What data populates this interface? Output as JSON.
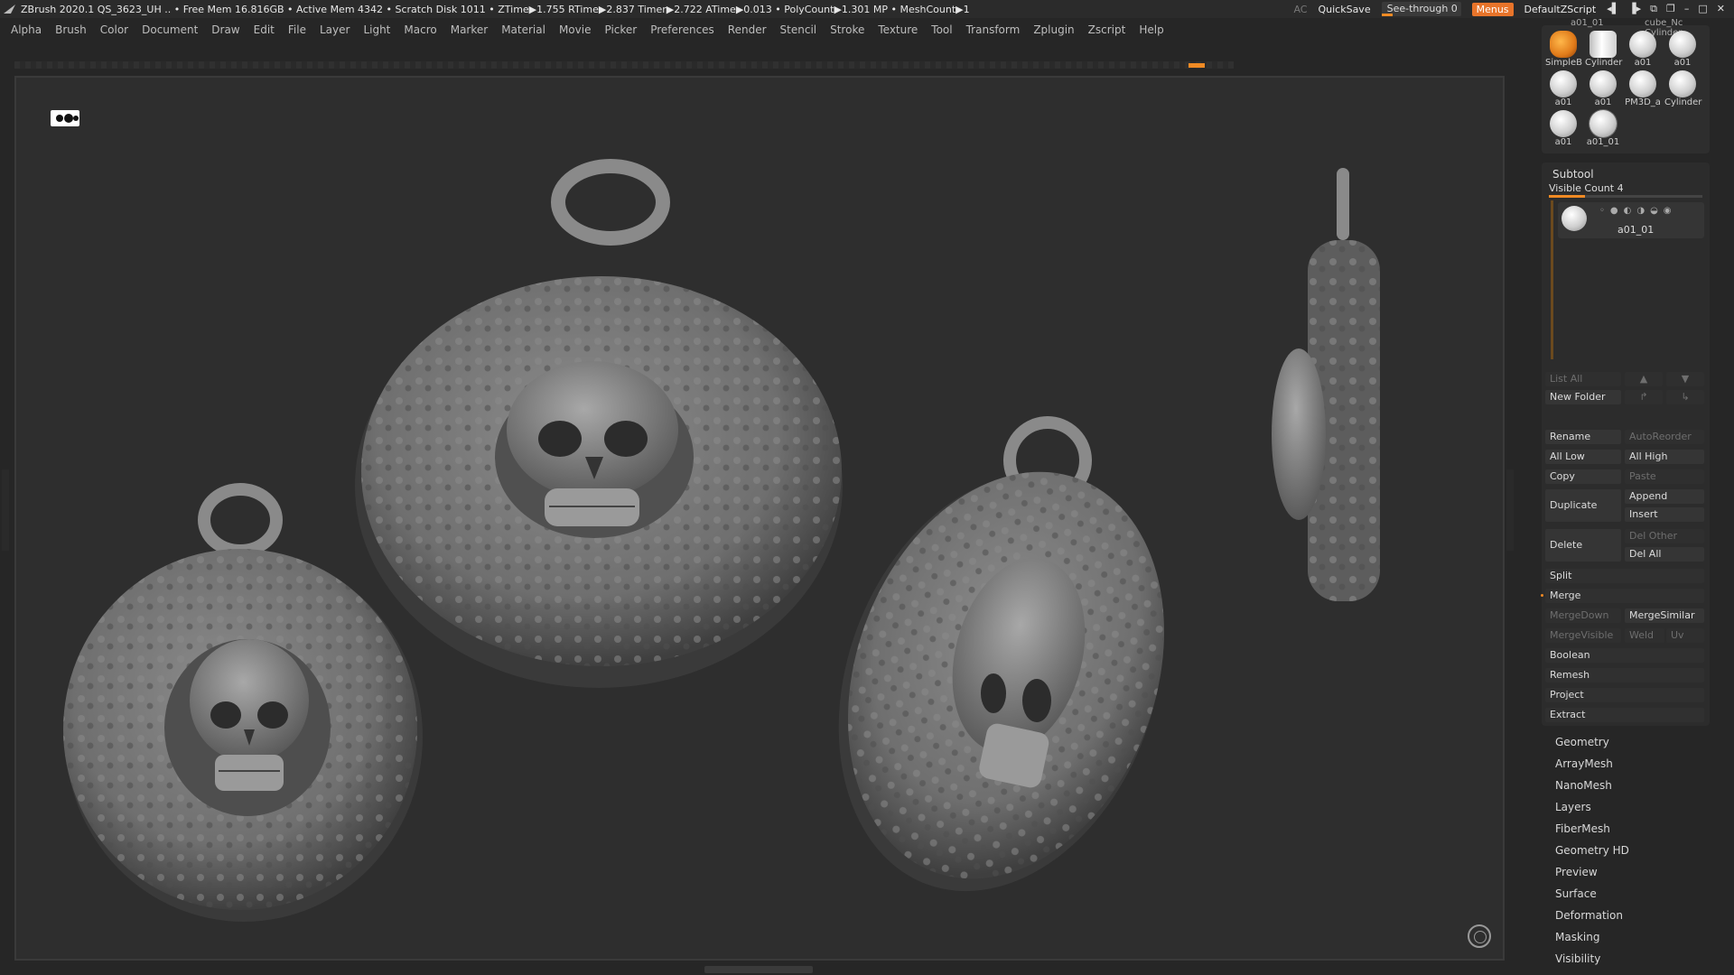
{
  "titlebar": {
    "info": "ZBrush 2020.1   QS_3623_UH   .. • Free Mem 16.816GB • Active Mem 4342 • Scratch Disk 1011 • ZTime▶1.755 RTime▶2.837 Timer▶2.722 ATime▶0.013 • PolyCount▶1.301 MP  • MeshCount▶1",
    "ac": "AC",
    "quicksave": "QuickSave",
    "see_through": "See-through  0",
    "menus": "Menus",
    "default_zscript": "DefaultZScript"
  },
  "menubar": [
    "Alpha",
    "Brush",
    "Color",
    "Document",
    "Draw",
    "Edit",
    "File",
    "Layer",
    "Light",
    "Macro",
    "Marker",
    "Material",
    "Movie",
    "Picker",
    "Preferences",
    "Render",
    "Stencil",
    "Stroke",
    "Texture",
    "Tool",
    "Transform",
    "Zplugin",
    "Zscript",
    "Help"
  ],
  "tools": [
    {
      "label": "SimpleB",
      "kind": "orange"
    },
    {
      "label": "Cylinder",
      "kind": "cyl"
    },
    {
      "label": "a01",
      "kind": "sphere"
    },
    {
      "label": "a01",
      "kind": "sphere"
    },
    {
      "label": "a01",
      "kind": "sphere"
    },
    {
      "label": "a01",
      "kind": "sphere"
    },
    {
      "label": "PM3D_a",
      "kind": "sphere"
    },
    {
      "label": "Cylinder",
      "kind": "sphere"
    },
    {
      "label": "a01",
      "kind": "sphere"
    },
    {
      "label": "a01_01",
      "kind": "sphere"
    }
  ],
  "tools_top": [
    "a01_01",
    "cube_Nc Cylinder"
  ],
  "subtool": {
    "title": "Subtool",
    "visible_count": "Visible Count 4",
    "item_name": "a01_01",
    "item_icons": "◦●◐◑◒◉",
    "list_all": "List All",
    "new_folder": "New Folder",
    "rename": "Rename",
    "autoreorder": "AutoReorder",
    "all_low": "All Low",
    "all_high": "All High",
    "copy": "Copy",
    "paste": "Paste",
    "duplicate": "Duplicate",
    "append": "Append",
    "insert": "Insert",
    "delete": "Delete",
    "del_other": "Del Other",
    "del_all": "Del All",
    "split": "Split",
    "merge": "Merge",
    "mergedown": "MergeDown",
    "mergesimilar": "MergeSimilar",
    "mergevisible": "MergeVisible",
    "weld": "Weld",
    "uv": "Uv",
    "boolean": "Boolean",
    "remesh": "Remesh",
    "project": "Project",
    "extract": "Extract"
  },
  "palettes": [
    "Geometry",
    "ArrayMesh",
    "NanoMesh",
    "Layers",
    "FiberMesh",
    "Geometry HD",
    "Preview",
    "Surface",
    "Deformation",
    "Masking",
    "Visibility"
  ]
}
